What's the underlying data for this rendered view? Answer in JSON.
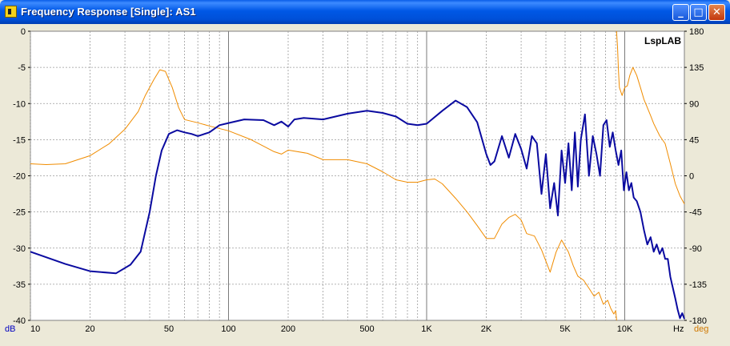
{
  "window": {
    "title": "Frequency Response [Single]: AS1",
    "minimize_glyph": "_",
    "maximize_glyph": "□",
    "close_glyph": "✕",
    "icon": "speaker-icon",
    "titlebar_color": "#0054E3"
  },
  "chart_data": {
    "type": "line",
    "watermark": "LspLAB",
    "x_scale": "log",
    "xlim": [
      10,
      20000
    ],
    "x_ticks": [
      10,
      20,
      50,
      100,
      200,
      500,
      1000,
      2000,
      5000,
      10000
    ],
    "x_tick_labels": [
      "10",
      "20",
      "50",
      "100",
      "200",
      "500",
      "1K",
      "2K",
      "5K",
      "10K"
    ],
    "x_unit": "Hz",
    "y_left": {
      "unit": "dB",
      "lim": [
        -40,
        0
      ],
      "ticks": [
        0,
        -5,
        -10,
        -15,
        -20,
        -25,
        -30,
        -35,
        -40
      ],
      "tick_labels": [
        "0",
        "-5",
        "-10",
        "-15",
        "-20",
        "-25",
        "-30",
        "-35",
        "-40"
      ]
    },
    "y_right": {
      "unit": "deg",
      "lim": [
        -180,
        180
      ],
      "ticks": [
        180,
        135,
        90,
        45,
        0,
        -45,
        -90,
        -135,
        -180
      ],
      "tick_labels": [
        "180",
        "135",
        "90",
        "45",
        "0",
        "-45",
        "-90",
        "-135",
        "-180"
      ]
    },
    "grid": true,
    "series": [
      {
        "axis": "left",
        "color": "#0A0AA0",
        "x": [
          10,
          15,
          20,
          27,
          32,
          36,
          40,
          43,
          46,
          50,
          55,
          60,
          65,
          70,
          80,
          90,
          100,
          120,
          150,
          170,
          185,
          200,
          215,
          240,
          300,
          400,
          500,
          600,
          700,
          800,
          900,
          1000,
          1200,
          1400,
          1600,
          1800,
          2000,
          2100,
          2200,
          2400,
          2600,
          2800,
          3000,
          3200,
          3400,
          3600,
          3800,
          4000,
          4200,
          4400,
          4600,
          4800,
          5000,
          5200,
          5400,
          5600,
          5800,
          6000,
          6300,
          6600,
          6900,
          7200,
          7500,
          7800,
          8100,
          8400,
          8700,
          9000,
          9300,
          9600,
          9900,
          10200,
          10500,
          10800,
          11100,
          11500,
          12000,
          12500,
          13000,
          13500,
          14000,
          14500,
          15000,
          15500,
          16000,
          16500,
          17000,
          17500,
          18000,
          18500,
          19000,
          19500,
          20000
        ],
        "y": [
          -30.5,
          -32.2,
          -33.2,
          -33.5,
          -32.3,
          -30.5,
          -25,
          -20,
          -16.5,
          -14.2,
          -13.7,
          -14.0,
          -14.2,
          -14.5,
          -14.0,
          -13.0,
          -12.7,
          -12.2,
          -12.3,
          -13.0,
          -12.5,
          -13.2,
          -12.2,
          -12.0,
          -12.2,
          -11.4,
          -11.0,
          -11.3,
          -11.8,
          -12.8,
          -13.0,
          -12.8,
          -11.0,
          -9.6,
          -10.5,
          -12.6,
          -17.0,
          -18.5,
          -18.0,
          -14.5,
          -17.5,
          -14.2,
          -16.3,
          -19.0,
          -14.5,
          -15.5,
          -22.5,
          -17.0,
          -24.5,
          -21.0,
          -25.5,
          -16.5,
          -21.0,
          -15.5,
          -22.0,
          -14.0,
          -21.5,
          -15.0,
          -11.5,
          -20.0,
          -14.5,
          -17.0,
          -20.0,
          -13.0,
          -12.3,
          -16.0,
          -14.0,
          -16.5,
          -18.5,
          -16.5,
          -22.0,
          -19.5,
          -22.0,
          -21.0,
          -23.0,
          -23.5,
          -25.0,
          -27.5,
          -29.5,
          -28.5,
          -30.5,
          -29.5,
          -30.8,
          -30.0,
          -31.5,
          -31.5,
          -34.0,
          -35.5,
          -37.0,
          -38.5,
          -39.7,
          -39.0,
          -39.8
        ]
      },
      {
        "axis": "right",
        "color": "#F08C00",
        "x": [
          10,
          12,
          15,
          20,
          25,
          30,
          35,
          38,
          42,
          45,
          48,
          52,
          56,
          60,
          70,
          80,
          100,
          130,
          150,
          170,
          185,
          200,
          250,
          300,
          400,
          500,
          600,
          700,
          800,
          900,
          1000,
          1100,
          1200,
          1400,
          1600,
          1800,
          2000,
          2200,
          2400,
          2600,
          2800,
          3000,
          3200,
          3500,
          3800,
          4200,
          4500,
          4800,
          5200,
          5500,
          5800,
          6200,
          6600,
          7000,
          7400,
          7800,
          8200,
          8500,
          8800,
          9000,
          9100,
          9200,
          9300,
          9400,
          9700,
          10000,
          10300,
          10600,
          11000,
          11500,
          12000,
          12500,
          13000,
          13500,
          14000,
          15000,
          16000,
          17000,
          18000,
          19000,
          20000
        ],
        "y": [
          15,
          14,
          15,
          25,
          40,
          58,
          80,
          100,
          120,
          132,
          130,
          110,
          85,
          70,
          66,
          62,
          56,
          45,
          37,
          30,
          27,
          32,
          28,
          20,
          20,
          15,
          5,
          -5,
          -8,
          -8,
          -5,
          -4,
          -10,
          -28,
          -45,
          -62,
          -78,
          -78,
          -60,
          -52,
          -48,
          -55,
          -72,
          -75,
          -92,
          -120,
          -95,
          -80,
          -95,
          -112,
          -125,
          -130,
          -140,
          -150,
          -145,
          -160,
          -155,
          -165,
          -172,
          -168,
          178,
          160,
          130,
          110,
          100,
          110,
          112,
          125,
          135,
          125,
          110,
          95,
          85,
          75,
          65,
          50,
          40,
          15,
          -10,
          -25,
          -35
        ]
      }
    ]
  }
}
